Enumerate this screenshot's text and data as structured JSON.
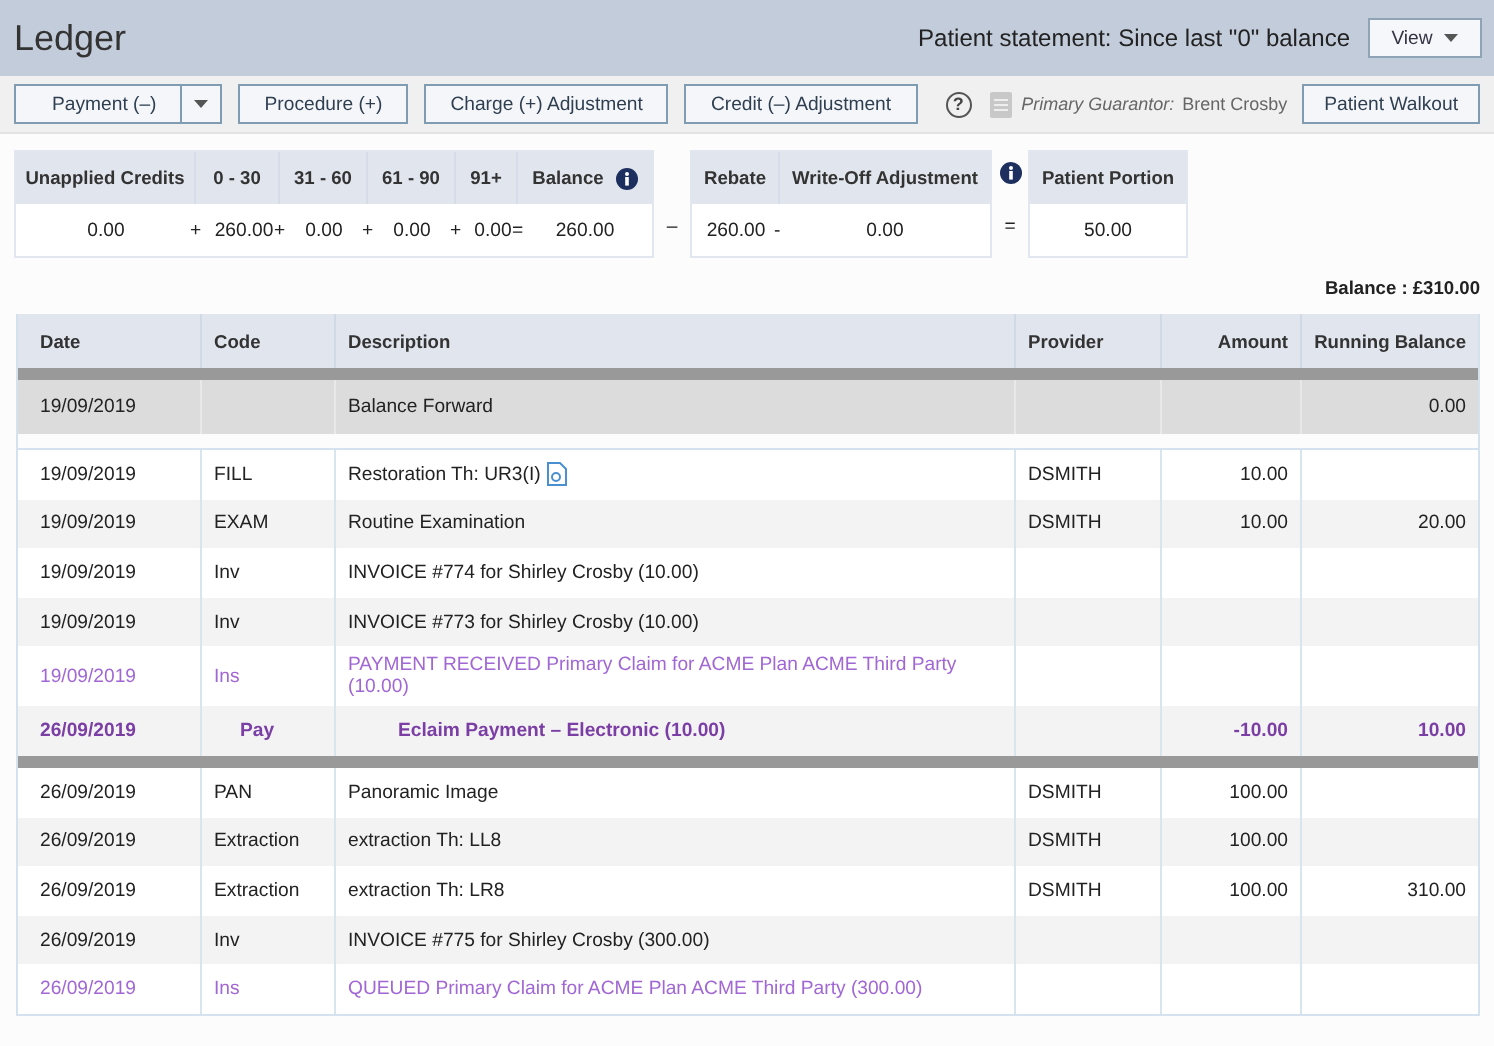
{
  "header": {
    "title": "Ledger",
    "statement": "Patient statement: Since last \"0\" balance",
    "view_button": "View"
  },
  "toolbar": {
    "buttons": [
      {
        "label": "Payment (–)",
        "kind": "split"
      },
      {
        "label": "Procedure (+)",
        "kind": "plain"
      },
      {
        "label": "Charge (+) Adjustment",
        "kind": "plain"
      },
      {
        "label": "Credit (–) Adjustment",
        "kind": "plain"
      }
    ],
    "help": "?",
    "guarantor_label": "Primary Guarantor:",
    "guarantor_name": "Brent Crosby",
    "walkout_button": "Patient Walkout"
  },
  "summary": {
    "aging": [
      {
        "header": "Unapplied Credits",
        "value": "0.00"
      },
      {
        "header": "0 - 30",
        "op": "+",
        "value": "260.00"
      },
      {
        "header": "31 - 60",
        "op": "+",
        "value": "0.00"
      },
      {
        "header": "61 - 90",
        "op": "+",
        "value": "0.00"
      },
      {
        "header": "91+",
        "op": "+",
        "value": "0.00"
      },
      {
        "header": "Balance",
        "op": "=",
        "value": "260.00",
        "info": true
      }
    ],
    "minus": "–",
    "adjustments": [
      {
        "header": "Rebate",
        "value": "260.00"
      },
      {
        "header": "Write-Off Adjustment",
        "op": "-",
        "value": "0.00"
      }
    ],
    "equals": "=",
    "portion": {
      "header": "Patient Portion",
      "value": "50.00"
    }
  },
  "balance_total": "Balance : £310.00",
  "table": {
    "columns": [
      "Date",
      "Code",
      "Description",
      "Provider",
      "Amount",
      "Running Balance"
    ],
    "balance_forward": {
      "date": "19/09/2019",
      "description": "Balance Forward",
      "running": "0.00"
    },
    "groups": [
      {
        "rows": [
          {
            "kind": "charge",
            "date": "19/09/2019",
            "code": "FILL",
            "description": "Restoration Th: UR3(I)",
            "attachment": true,
            "provider": "DSMITH",
            "amount": "10.00"
          },
          {
            "kind": "charge",
            "date": "19/09/2019",
            "code": "EXAM",
            "description": "Routine Examination",
            "provider": "DSMITH",
            "amount": "10.00",
            "running": "20.00"
          },
          {
            "kind": "charge",
            "date": "19/09/2019",
            "code": "Inv",
            "description": "INVOICE #774 for Shirley Crosby (10.00)"
          },
          {
            "kind": "charge",
            "date": "19/09/2019",
            "code": "Inv",
            "description": "INVOICE #773 for Shirley Crosby (10.00)"
          },
          {
            "kind": "claim",
            "date": "19/09/2019",
            "code": "Ins",
            "description": "PAYMENT RECEIVED Primary Claim for ACME Plan ACME Third Party (10.00)"
          },
          {
            "kind": "payment",
            "date": "26/09/2019",
            "code": "Pay",
            "description": "Eclaim Payment – Electronic (10.00)",
            "amount": "-10.00",
            "running": "10.00"
          }
        ]
      },
      {
        "rows": [
          {
            "kind": "charge",
            "date": "26/09/2019",
            "code": "PAN",
            "description": "Panoramic Image",
            "provider": "DSMITH",
            "amount": "100.00"
          },
          {
            "kind": "charge",
            "date": "26/09/2019",
            "code": "Extraction",
            "description": "extraction Th: LL8",
            "provider": "DSMITH",
            "amount": "100.00"
          },
          {
            "kind": "charge",
            "date": "26/09/2019",
            "code": "Extraction",
            "description": "extraction Th: LR8",
            "provider": "DSMITH",
            "amount": "100.00",
            "running": "310.00"
          },
          {
            "kind": "charge",
            "date": "26/09/2019",
            "code": "Inv",
            "description": "INVOICE #775 for Shirley Crosby (300.00)"
          },
          {
            "kind": "claim",
            "date": "26/09/2019",
            "code": "Ins",
            "description": "QUEUED Primary Claim for ACME Plan ACME Third Party (300.00)"
          }
        ]
      }
    ]
  }
}
